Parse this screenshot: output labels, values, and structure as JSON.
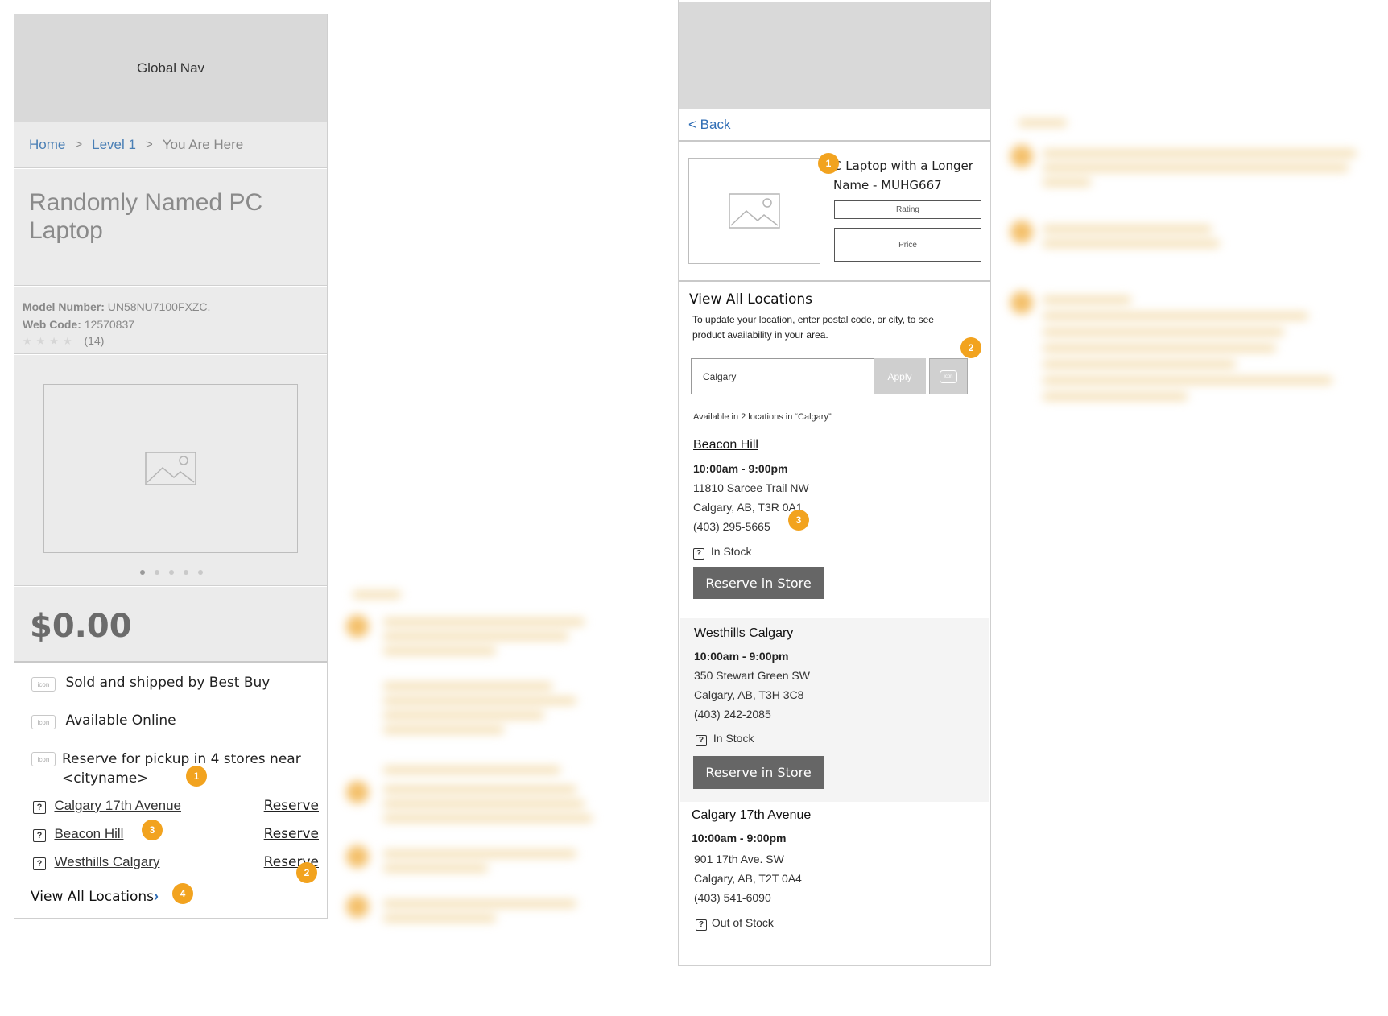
{
  "left": {
    "global_nav": "Global Nav",
    "breadcrumb": {
      "home": "Home",
      "level1": "Level 1",
      "current": "You Are Here",
      "sep": ">"
    },
    "product_title": "Randomly Named PC Laptop",
    "model_label": "Model Number:",
    "model_value": "UN58NU7100FXZC.",
    "webcode_label": "Web Code:",
    "webcode_value": "12570837",
    "stars": "★★★★",
    "review_count": "(14)",
    "price": "$0.00",
    "features": [
      {
        "icon": "icon",
        "text": "Sold and shipped by Best Buy"
      },
      {
        "icon": "icon",
        "text": "Available Online"
      },
      {
        "icon": "icon",
        "text": "Reserve for pickup in 4 stores near <cityname>"
      }
    ],
    "stores": [
      {
        "name": "Calgary 17th Avenue",
        "action": "Reserve"
      },
      {
        "name": "Beacon Hill",
        "action": "Reserve"
      },
      {
        "name": "Westhills Calgary",
        "action": "Reserve"
      }
    ],
    "view_all": "View All Locations",
    "view_all_chevron": "›"
  },
  "markers": {
    "m1": "1",
    "m2": "2",
    "m3": "3",
    "m4": "4"
  },
  "right": {
    "back": "< Back",
    "product_name": "C Laptop with a Longer Name - MUHG667",
    "rating_label": "Rating",
    "price_label": "Price",
    "view_all_heading": "View All Locations",
    "instruction": "To update your location, enter postal code, or city,  to see product availability in your area.",
    "search_value": "Calgary",
    "apply": "Apply",
    "icon_btn": "icon",
    "availability": "Available in 2 locations in “Calgary”",
    "stores": [
      {
        "name": "Beacon Hill",
        "hours": "10:00am - 9:00pm",
        "street": "11810 Sarcee Trail NW",
        "city": "Calgary, AB, T3R 0A1",
        "phone": "(403) 295-5665",
        "stock": "In Stock",
        "button": "Reserve in Store"
      },
      {
        "name": "Westhills Calgary",
        "hours": "10:00am - 9:00pm",
        "street": "350 Stewart Green SW",
        "city": "Calgary, AB, T3H 3C8",
        "phone": "(403) 242-2085",
        "stock": "In Stock",
        "button": "Reserve in Store"
      },
      {
        "name": "Calgary 17th Avenue",
        "hours": "10:00am - 9:00pm",
        "street": "901 17th Ave. SW",
        "city": "Calgary, AB, T2T 0A4",
        "phone": "(403) 541-6090",
        "stock": "Out of Stock"
      }
    ]
  },
  "colors": {
    "marker": "#f2a31f",
    "link_blue": "#2f6db5",
    "button_grey": "#666666",
    "nav_grey": "#d9d9d9"
  }
}
